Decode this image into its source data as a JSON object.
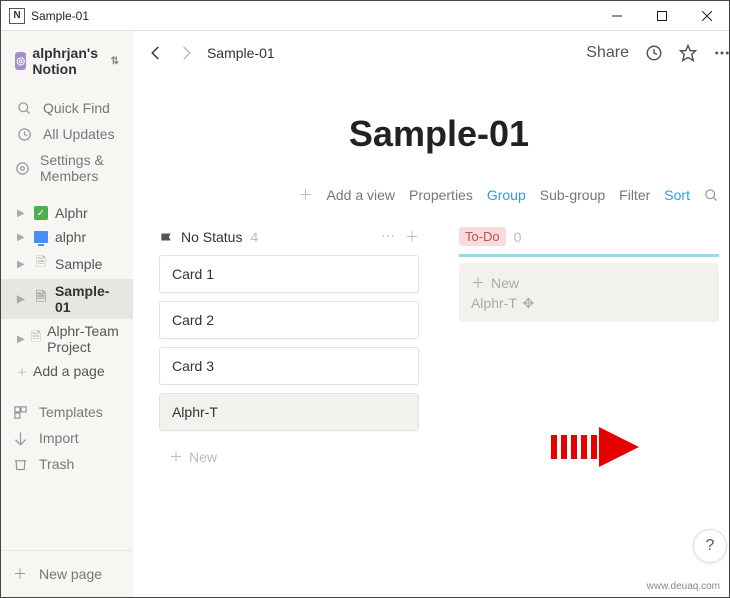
{
  "window": {
    "title": "Sample-01"
  },
  "workspace": {
    "name": "alphrjan's Notion"
  },
  "sidebar": {
    "utils": [
      {
        "label": "Quick Find"
      },
      {
        "label": "All Updates"
      },
      {
        "label": "Settings & Members"
      }
    ],
    "pages": [
      {
        "label": "Alphr"
      },
      {
        "label": "alphr"
      },
      {
        "label": "Sample"
      },
      {
        "label": "Sample-01"
      },
      {
        "label": "Alphr-Team Project"
      }
    ],
    "addPage": "Add a page",
    "tools": [
      {
        "label": "Templates"
      },
      {
        "label": "Import"
      },
      {
        "label": "Trash"
      }
    ],
    "newPage": "New page"
  },
  "topbar": {
    "breadcrumb": "Sample-01",
    "share": "Share"
  },
  "page": {
    "title": "Sample-01"
  },
  "tabs": {
    "addView": "Add a view",
    "properties": "Properties",
    "group": "Group",
    "subgroup": "Sub-group",
    "filter": "Filter",
    "sort": "Sort"
  },
  "board": {
    "col1": {
      "name": "No Status",
      "count": "4",
      "cards": [
        "Card 1",
        "Card 2",
        "Card 3",
        "Alphr-T"
      ],
      "new": "New"
    },
    "col2": {
      "name": "To-Do",
      "count": "0",
      "new": "New",
      "drop": "Alphr-T"
    }
  },
  "help": "?",
  "watermark": "www.deuaq.com"
}
